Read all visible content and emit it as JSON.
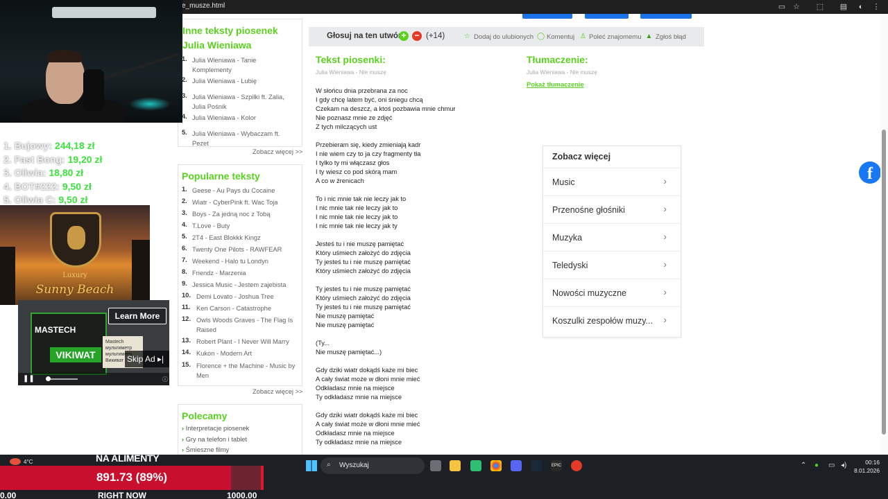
{
  "browser": {
    "url": "e_musze.html"
  },
  "sidebar": {
    "other_heading": "Inne teksty piosenek",
    "other_artist": "Julia Wieniawa",
    "other_items": [
      {
        "n": "1.",
        "t": "Julia Wieniawa - Tanie Komplementy"
      },
      {
        "n": "2.",
        "t": "Julia Wieniawa - Lubię"
      },
      {
        "n": "3.",
        "t": "Julia Wieniawa - Szpilki ft. Zalia, Julia Pośnik"
      },
      {
        "n": "4.",
        "t": "Julia Wieniawa - Kolor"
      },
      {
        "n": "5.",
        "t": "Julia Wieniawa - Wybaczam ft. Pezet"
      }
    ],
    "more_label": "Zobacz więcej >>",
    "popular_heading": "Popularne teksty",
    "popular_items": [
      {
        "n": "1.",
        "t": "Geese - Au Pays du Cocaine"
      },
      {
        "n": "2.",
        "t": "Wiatr - CyberPink ft. Wac Toja"
      },
      {
        "n": "3.",
        "t": "Boys - Za jedną noc z Tobą"
      },
      {
        "n": "4.",
        "t": "T.Love - Buty"
      },
      {
        "n": "5.",
        "t": "2T4 - East Blokkk Kingz"
      },
      {
        "n": "6.",
        "t": "Twenty One Pilots - RAWFEAR"
      },
      {
        "n": "7.",
        "t": "Weekend - Halo tu Londyn"
      },
      {
        "n": "8.",
        "t": "Friendz - Marzenia"
      },
      {
        "n": "9.",
        "t": "Jessica Music - Jestem zajebista"
      },
      {
        "n": "10.",
        "t": "Demi Lovato - Joshua Tree"
      },
      {
        "n": "11.",
        "t": "Ken Carson - Catastrophe"
      },
      {
        "n": "12.",
        "t": "Owls Woods Graves - The Flag Is Raised"
      },
      {
        "n": "13.",
        "t": "Robert Plant - I Never Will Marry"
      },
      {
        "n": "14.",
        "t": "Kukon - Modern Art"
      },
      {
        "n": "15.",
        "t": "Florence + the Machine - Music by Men"
      }
    ],
    "recommend_heading": "Polecamy",
    "recommend_items": [
      "Interpretacje piosenek",
      "Gry na telefon i tablet",
      "Śmieszne filmy"
    ]
  },
  "vote": {
    "label": "Głosuj na ten utwór",
    "plus": "+",
    "minus": "−",
    "count": "(+14)",
    "actions": [
      "Dodaj do ulubionych",
      "Komentuj",
      "Poleć znajomemu",
      "Zgłoś błąd"
    ]
  },
  "lyrics": {
    "title": "Tekst piosenki:",
    "subtitle": "Julia Wieniawa - Nie muszę",
    "lines": [
      "W słońcu dnia przebrana za noc",
      "I gdy chcę latem być, oni śniegu chcą",
      "Czekam na deszcz, a ktoś pozbawia mnie chmur",
      "Nie poznasz mnie ze zdjęć",
      "Z tych milczących ust",
      "",
      "Przebieram się, kiedy zmieniają kadr",
      "I nie wiem czy to ja czy fragmenty tła",
      "I tylko ty mi włączasz głos",
      "I ty wiesz co pod skórą mam",
      "A co w źrenicach",
      "",
      "To i nic mnie tak nie leczy jak to",
      "I nic mnie tak nie leczy jak to",
      "I nic mnie tak nie leczy jak to",
      "I nic mnie tak nie leczy jak ty",
      "",
      "Jesteś tu i nie muszę pamiętać",
      "Który uśmiech założyć do zdjęcia",
      "Ty jesteś tu i nie muszę pamiętać",
      "Który uśmiech założyć do zdjęcia",
      "",
      "Ty jesteś tu i nie muszę pamiętać",
      "Który uśmiech założyć do zdjęcia",
      "Ty jesteś tu i nie muszę pamiętać",
      "Nie muszę pamiętać",
      "Nie muszę pamiętać",
      "",
      "(Ty...",
      "Nie muszę pamiętać...)",
      "",
      "Gdy dziki wiatr dokądś każe mi biec",
      "A cały świat może w dłoni mnie mieć",
      "Odkładasz mnie na miejsce",
      "Ty odkładasz mnie na miejsce",
      "",
      "Gdy dziki wiatr dokądś każe mi biec",
      "A cały świat może w dłoni mnie mieć",
      "Odkładasz mnie na miejsce",
      "Ty odkładasz mnie na miejsce"
    ]
  },
  "translation": {
    "title": "Tłumaczenie:",
    "subtitle": "Julia Wieniawa - Nie muszę",
    "link": "Pokaż tłumaczenie"
  },
  "see_more": {
    "title": "Zobacz więcej",
    "items": [
      "Music",
      "Przenośne głośniki",
      "Muzyka",
      "Teledyski",
      "Nowości muzyczne",
      "Koszulki zespołów muzy..."
    ]
  },
  "stream": {
    "donations": [
      {
        "name": "1. Bujowy:",
        "amount": "244,18 zł"
      },
      {
        "name": "2. Fast Bong:",
        "amount": "19,20 zł"
      },
      {
        "name": "3. Oliwia:",
        "amount": "18,80 zł"
      },
      {
        "name": "4. BOT#222:",
        "amount": "9,50 zł"
      },
      {
        "name": "5. Oliwia C:",
        "amount": "9,50 zł"
      }
    ],
    "barber": {
      "luxury": "Luxury",
      "name": "Sunny Beach"
    },
    "ad": {
      "brand": "MASTECH",
      "product": "VIKIWAT",
      "info": "Mastech мультиметр мультиметр Викиват",
      "learn": "Learn More",
      "skip": "Skip Ad ▸|"
    },
    "goal": {
      "title": "NA ALIMENTY",
      "value": "891.73 (89%)",
      "progress_fraction": 0.8917,
      "min": "0.00",
      "mid": "RIGHT NOW",
      "max": "1000.00"
    }
  },
  "taskbar": {
    "search": "Wyszukaj",
    "temp": "4°C",
    "time": "00:16",
    "date": "8.01.2026"
  }
}
